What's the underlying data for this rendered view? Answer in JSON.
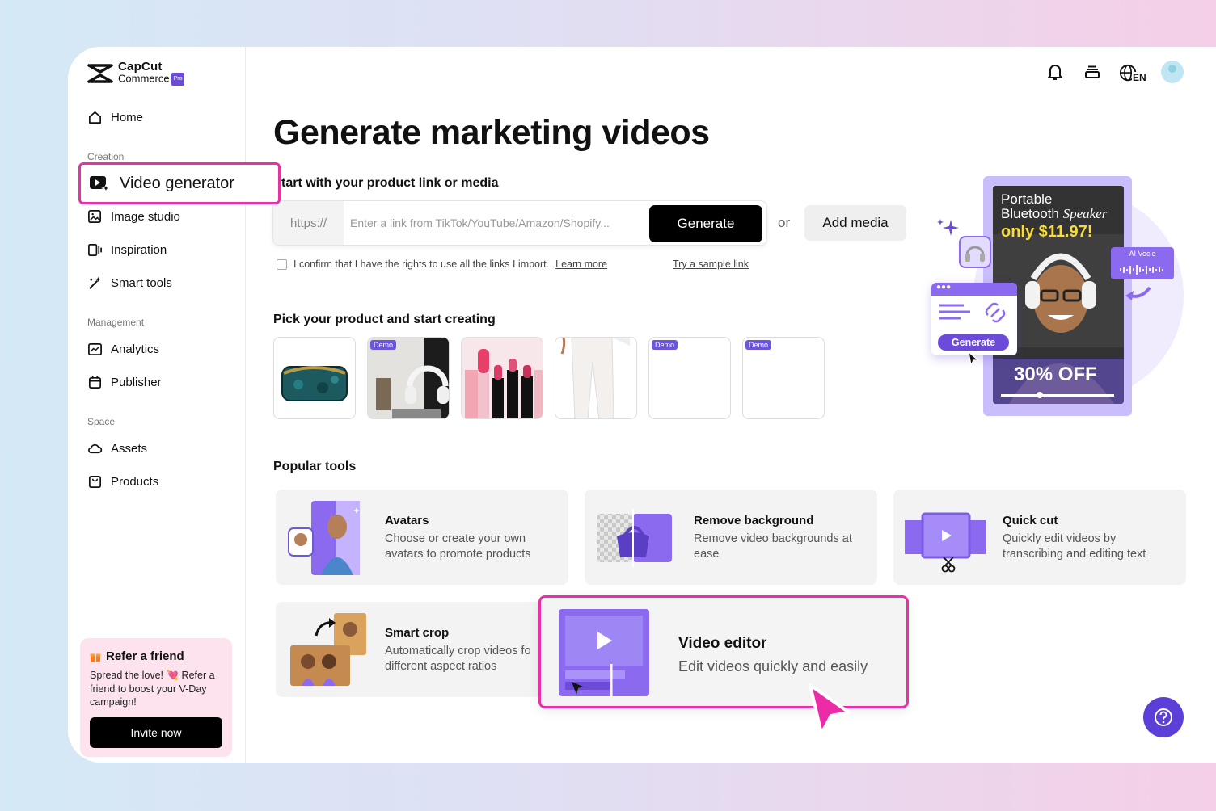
{
  "app": {
    "brand_line1": "CapCut",
    "brand_line2": "Commerce",
    "pro_badge": "Pro"
  },
  "sidebar": {
    "home": "Home",
    "creation_label": "Creation",
    "video_generator": "Video generator",
    "image_studio": "Image studio",
    "inspiration": "Inspiration",
    "smart_tools": "Smart tools",
    "management_label": "Management",
    "analytics": "Analytics",
    "publisher": "Publisher",
    "space_label": "Space",
    "assets": "Assets",
    "products": "Products"
  },
  "refer": {
    "title": "Refer a friend",
    "description": "Spread the love! 💘 Refer a friend to boost your V-Day campaign!",
    "button": "Invite now"
  },
  "header": {
    "language": "EN"
  },
  "main": {
    "title": "Generate marketing videos",
    "subtitle": "tart with your product link or media",
    "url_prefix": "https://",
    "url_placeholder": "Enter a link from TikTok/YouTube/Amazon/Shopify...",
    "generate_button": "Generate",
    "or_text": "or",
    "add_media_button": "Add media",
    "confirm_text": "I confirm that I have the rights to use all the links I import.",
    "learn_more": "Learn more",
    "sample_link": "Try a sample link",
    "pick_title": "Pick your product and start creating",
    "demo_badge": "Demo",
    "popular_title": "Popular tools"
  },
  "tools": [
    {
      "title": "Avatars",
      "description": "Choose or create your own avatars to promote products"
    },
    {
      "title": "Remove background",
      "description": "Remove video backgrounds at ease"
    },
    {
      "title": "Quick cut",
      "description": "Quickly edit videos by transcribing and editing text"
    },
    {
      "title": "Smart crop",
      "description": "Automatically crop videos fo different aspect ratios"
    },
    {
      "title": "Video editor",
      "description": "Edit videos quickly and easily"
    }
  ],
  "promo": {
    "line1": "Portable",
    "line2a": "Bluetooth ",
    "line2b": "Speaker",
    "price": "only $11.97!",
    "ai_voice": "AI Vocie",
    "generate": "Generate",
    "discount": "30% OFF"
  },
  "colors": {
    "accent": "#ea2fa8",
    "purple": "#6b4bd8",
    "black": "#000000"
  }
}
